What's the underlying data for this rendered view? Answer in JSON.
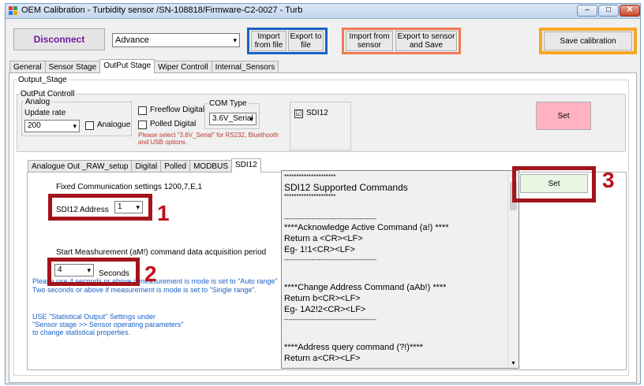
{
  "window": {
    "title": "OEM Calibration - Turbidity sensor /SN-108818/Firmware-C2-0027 - Turb",
    "controls": {
      "minimize": "–",
      "maximize": "□",
      "close": "✕"
    }
  },
  "toolbar": {
    "disconnect_label": "Disconnect",
    "mode_value": "Advance",
    "import_file_label": "Import from file",
    "export_file_label": "Export to file",
    "import_sensor_label": "Import from sensor",
    "export_sensor_label": "Export to sensor and Save",
    "save_calibration_label": "Save calibration",
    "colors": {
      "disconnect_text": "#6b1a9e",
      "file_group": "#1a62c6",
      "sensor_group": "#f07a52",
      "save_group": "#f5a623"
    }
  },
  "main_tabs": [
    "General",
    "Sensor Stage",
    "OutPut Stage",
    "Wiper Controll",
    "Internal_Sensors"
  ],
  "output_stage": {
    "group_title": "Output_Stage",
    "controll_title": "OutPut Controll",
    "analog": {
      "title": "Analog",
      "update_rate_label": "Update rate",
      "update_rate_value": "200",
      "analogue_label": "Analogue"
    },
    "freeflow_label": "Freeflow Digital",
    "polled_label": "Polled Digital",
    "com_type": {
      "title": "COM Type",
      "value": "3.6V_Serial"
    },
    "note": "Please select \"3.6V_Serial\" for RS232, Bluethooth and USB options.",
    "sdi12_label": "SDI12",
    "sdi12_checked": "☑",
    "set_label": "Set",
    "set_color": "#ffb3c1"
  },
  "sub_tabs": [
    "Analogue Out _RAW_setup",
    "Digital",
    "Polled",
    "MODBUS",
    "SDI12"
  ],
  "sdi12_page": {
    "fixed_settings": "Fixed Communication settings 1200,7,E,1",
    "address_label": "SDI12 Address",
    "address_value": "1",
    "measurement_label": "Start Meashurement (aM!) command data acquisition period",
    "period_value": "4",
    "period_unit": "Seconds",
    "info_line1": "Please use 4 seconds or above if measurement is mode is set to \"Auto range\"",
    "info_line2": "Two seconds or above if measurement is mode is set to \"Single range\".",
    "stat_line1": "USE \"Statistical Output\" Settings under",
    "stat_line2": "\"Sensor stage >> Sensor operating parameters\"",
    "stat_line3": "to change statistical properties.",
    "set_label": "Set",
    "set_color": "#eaf6e4"
  },
  "commands_text": [
    "*********************",
    "SDI12 Supported Commands",
    "*********************",
    "--------------------------------------------",
    "****Acknowledge Active Command (a!) ****",
    "Return a <CR><LF>",
    "Eg- 1!1<CR><LF>",
    "--------------------------------------------",
    "****Change Address Command (aAb!) ****",
    "Return b<CR><LF>",
    "Eg- 1A2!2<CR><LF>",
    "--------------------------------------------",
    "****Address query command (?!)****",
    "Return a<CR><LF>"
  ],
  "callouts": [
    "1",
    "2",
    "3"
  ],
  "icons": {
    "dropdown": "chevron-down-icon",
    "scroll_up": "▲",
    "scroll_down": "▼",
    "combo_arrow": "▾"
  }
}
